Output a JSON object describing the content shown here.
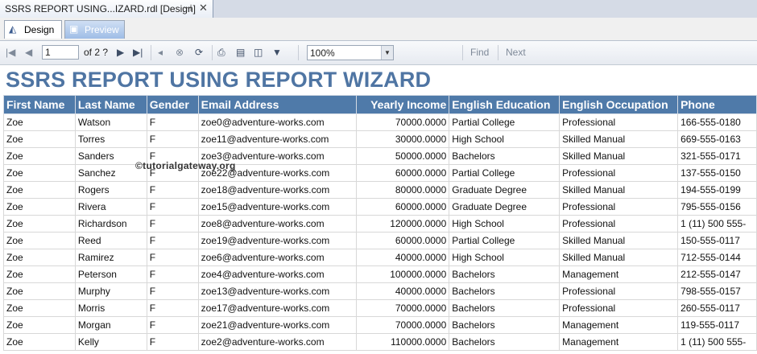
{
  "doc_tab": {
    "title": "SSRS REPORT USING...IZARD.rdl [Design]",
    "pin_icon": "pin-icon",
    "close_icon": "close-icon"
  },
  "mode_tabs": [
    {
      "label": "Design",
      "icon": "design-icon"
    },
    {
      "label": "Preview",
      "icon": "preview-icon"
    }
  ],
  "toolbar": {
    "page_value": "1",
    "of_label": "of  2 ?",
    "zoom": "100%",
    "find_label": "Find",
    "next_label": "Next"
  },
  "report": {
    "title": "SSRS REPORT USING REPORT WIZARD",
    "watermark": "©tutorialgateway.org",
    "columns": [
      "First Name",
      "Last Name",
      "Gender",
      "Email Address",
      "Yearly Income",
      "English Education",
      "English Occupation",
      "Phone"
    ],
    "rows": [
      [
        "Zoe",
        "Watson",
        "F",
        "zoe0@adventure-works.com",
        "70000.0000",
        "Partial College",
        "Professional",
        "166-555-0180"
      ],
      [
        "Zoe",
        "Torres",
        "F",
        "zoe11@adventure-works.com",
        "30000.0000",
        "High School",
        "Skilled Manual",
        "669-555-0163"
      ],
      [
        "Zoe",
        "Sanders",
        "F",
        "zoe3@adventure-works.com",
        "50000.0000",
        "Bachelors",
        "Skilled Manual",
        "321-555-0171"
      ],
      [
        "Zoe",
        "Sanchez",
        "F",
        "zoe22@adventure-works.com",
        "60000.0000",
        "Partial College",
        "Professional",
        "137-555-0150"
      ],
      [
        "Zoe",
        "Rogers",
        "F",
        "zoe18@adventure-works.com",
        "80000.0000",
        "Graduate Degree",
        "Skilled Manual",
        "194-555-0199"
      ],
      [
        "Zoe",
        "Rivera",
        "F",
        "zoe15@adventure-works.com",
        "60000.0000",
        "Graduate Degree",
        "Professional",
        "795-555-0156"
      ],
      [
        "Zoe",
        "Richardson",
        "F",
        "zoe8@adventure-works.com",
        "120000.0000",
        "High School",
        "Professional",
        "1 (11) 500 555-"
      ],
      [
        "Zoe",
        "Reed",
        "F",
        "zoe19@adventure-works.com",
        "60000.0000",
        "Partial College",
        "Skilled Manual",
        "150-555-0117"
      ],
      [
        "Zoe",
        "Ramirez",
        "F",
        "zoe6@adventure-works.com",
        "40000.0000",
        "High School",
        "Skilled Manual",
        "712-555-0144"
      ],
      [
        "Zoe",
        "Peterson",
        "F",
        "zoe4@adventure-works.com",
        "100000.0000",
        "Bachelors",
        "Management",
        "212-555-0147"
      ],
      [
        "Zoe",
        "Murphy",
        "F",
        "zoe13@adventure-works.com",
        "40000.0000",
        "Bachelors",
        "Professional",
        "798-555-0157"
      ],
      [
        "Zoe",
        "Morris",
        "F",
        "zoe17@adventure-works.com",
        "70000.0000",
        "Bachelors",
        "Professional",
        "260-555-0117"
      ],
      [
        "Zoe",
        "Morgan",
        "F",
        "zoe21@adventure-works.com",
        "70000.0000",
        "Bachelors",
        "Management",
        "119-555-0117"
      ],
      [
        "Zoe",
        "Kelly",
        "F",
        "zoe2@adventure-works.com",
        "110000.0000",
        "Bachelors",
        "Management",
        "1 (11) 500 555-"
      ]
    ]
  }
}
